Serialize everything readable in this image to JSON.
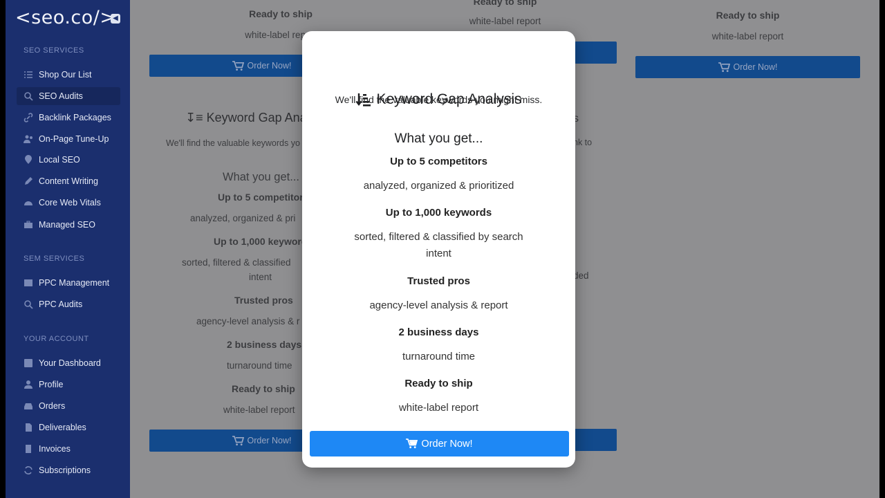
{
  "logo": "<seo.co/>",
  "sidebar": {
    "sections": [
      {
        "title": "SEO SERVICES",
        "items": [
          "Shop Our List",
          "SEO Audits",
          "Backlink Packages",
          "On-Page Tune-Up",
          "Local SEO",
          "Content Writing",
          "Core Web Vitals",
          "Managed SEO"
        ]
      },
      {
        "title": "SEM SERVICES",
        "items": [
          "PPC Management",
          "PPC Audits"
        ]
      },
      {
        "title": "YOUR ACCOUNT",
        "items": [
          "Your Dashboard",
          "Profile",
          "Orders",
          "Deliverables",
          "Invoices",
          "Subscriptions"
        ]
      }
    ],
    "active": "SEO Audits",
    "icons": [
      "list-icon",
      "search-icon",
      "link-icon",
      "users-icon",
      "map-pin-icon",
      "pen-icon",
      "gauge-icon",
      "briefcase-icon",
      "chart-icon",
      "search-icon",
      "dashboard-icon",
      "user-icon",
      "inbox-icon",
      "file-icon",
      "invoice-icon",
      "refresh-icon"
    ]
  },
  "background": {
    "card_top_left": {
      "ready": "Ready to ship",
      "report": "white-label report",
      "button": "Order Now!"
    },
    "card_top_center": {
      "ready": "Ready to ship",
      "report": "white-label report"
    },
    "card_top_right": {
      "ready": "Ready to ship",
      "report": "white-label report",
      "button": "Order Now!"
    },
    "card_left": {
      "title": "Keyword Gap Ana",
      "subtitle": "We'll find the valuable keywords yo",
      "what": "What you get...",
      "f1b": "Up to 5 competitors",
      "f1t": "analyzed, organized & pri",
      "f2b": "Up to 1,000 keywords",
      "f2t1": "sorted, filtered & classified",
      "f2t2": "intent",
      "f3b": "Trusted pros",
      "f3t": "agency-level analysis & r",
      "f4b": "2 business days",
      "f4t": "turnaround time",
      "f5b": "Ready to ship",
      "f5t": "white-label report",
      "button": "Order Now!"
    },
    "card_center_right": {
      "t1": "s",
      "t2": "nk to",
      "t3": "ded"
    }
  },
  "modal": {
    "title": "Keyword Gap Analysis",
    "subtitle": "We'll find the valuable keywords you might miss.",
    "heading": "What you get...",
    "features": [
      {
        "bold": "Up to 5 competitors",
        "text": "analyzed, organized & prioritized"
      },
      {
        "bold": "Up to 1,000 keywords",
        "text": "sorted, filtered & classified by search intent"
      },
      {
        "bold": "Trusted pros",
        "text": "agency-level analysis & report"
      },
      {
        "bold": "2 business days",
        "text": "turnaround time"
      },
      {
        "bold": "Ready to ship",
        "text": "white-label report"
      }
    ],
    "button": "Order Now!"
  },
  "colors": {
    "sidebar": "#1b2f6e",
    "overlay": "#8f8f91",
    "order_button": "#1e88f5",
    "bg_button": "#124a8c"
  }
}
